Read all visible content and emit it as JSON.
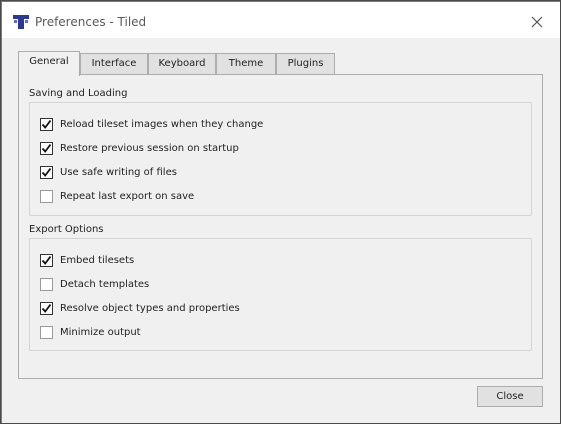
{
  "window": {
    "title": "Preferences - Tiled",
    "icon": "tiled-logo-icon",
    "close_icon": "close-icon"
  },
  "tabs": [
    {
      "label": "General",
      "active": true
    },
    {
      "label": "Interface",
      "active": false
    },
    {
      "label": "Keyboard",
      "active": false
    },
    {
      "label": "Theme",
      "active": false
    },
    {
      "label": "Plugins",
      "active": false
    }
  ],
  "sections": {
    "saving": {
      "title": "Saving and Loading",
      "options": [
        {
          "label": "Reload tileset images when they change",
          "checked": true
        },
        {
          "label": "Restore previous session on startup",
          "checked": true
        },
        {
          "label": "Use safe writing of files",
          "checked": true
        },
        {
          "label": "Repeat last export on save",
          "checked": false
        }
      ]
    },
    "export": {
      "title": "Export Options",
      "options": [
        {
          "label": "Embed tilesets",
          "checked": true
        },
        {
          "label": "Detach templates",
          "checked": false
        },
        {
          "label": "Resolve object types and properties",
          "checked": true
        },
        {
          "label": "Minimize output",
          "checked": false
        }
      ]
    }
  },
  "buttons": {
    "close_label": "Close"
  },
  "colors": {
    "accent": "#2b3a8f",
    "window_background": "#f0f0f0",
    "desktop": "#6e6e6e"
  }
}
